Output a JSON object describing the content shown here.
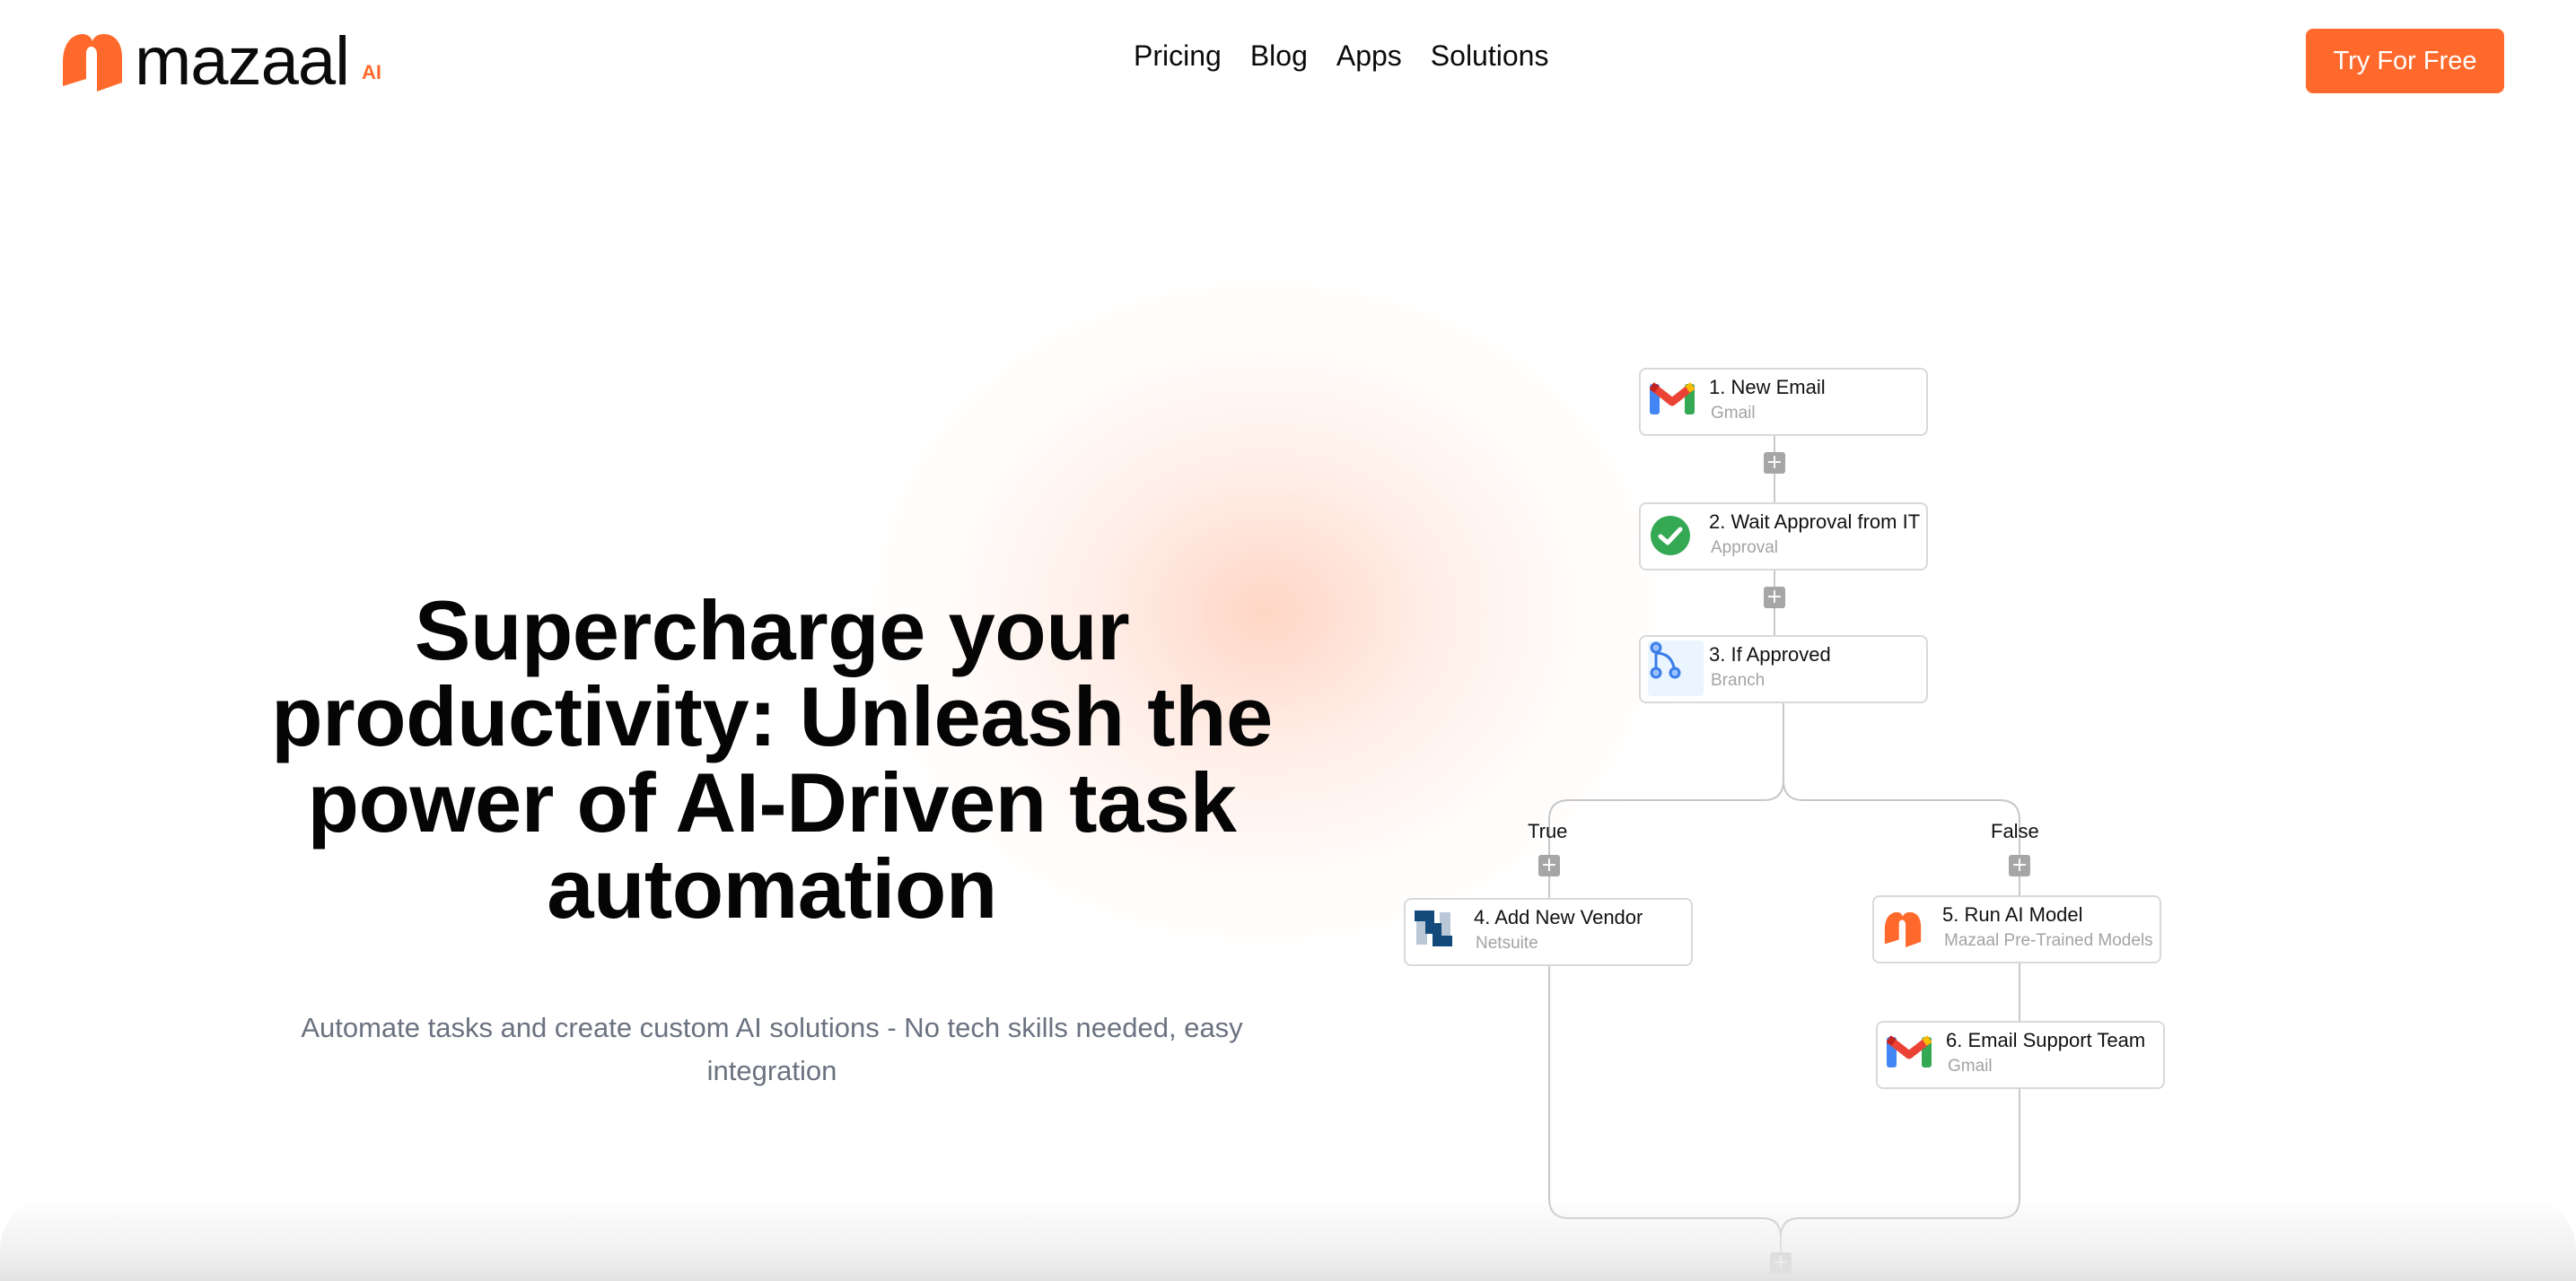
{
  "brand": {
    "name": "mazaal",
    "suffix": "AI",
    "accent_color": "#ff6a2c"
  },
  "nav": {
    "items": [
      {
        "label": "Pricing"
      },
      {
        "label": "Blog"
      },
      {
        "label": "Apps"
      },
      {
        "label": "Solutions"
      }
    ],
    "cta_label": "Try For Free"
  },
  "hero": {
    "title": "Supercharge your productivity: Unleash the power of AI-Driven task automation",
    "subtitle": "Automate tasks and create custom AI solutions - No tech skills needed, easy integration"
  },
  "workflow": {
    "steps": [
      {
        "title": "1. New Email",
        "app": "Gmail",
        "icon": "gmail-icon"
      },
      {
        "title": "2. Wait Approval from IT",
        "app": "Approval",
        "icon": "check-circle-icon"
      },
      {
        "title": "3. If Approved",
        "app": "Branch",
        "icon": "branch-icon"
      },
      {
        "title": "4. Add New Vendor",
        "app": "Netsuite",
        "icon": "netsuite-icon"
      },
      {
        "title": "5. Run AI Model",
        "app": "Mazaal Pre-Trained Models",
        "icon": "mazaal-icon"
      },
      {
        "title": "6. Email Support Team",
        "app": "Gmail",
        "icon": "gmail-icon"
      }
    ],
    "branch_labels": {
      "true": "True",
      "false": "False"
    },
    "add_step_symbol": "+"
  }
}
